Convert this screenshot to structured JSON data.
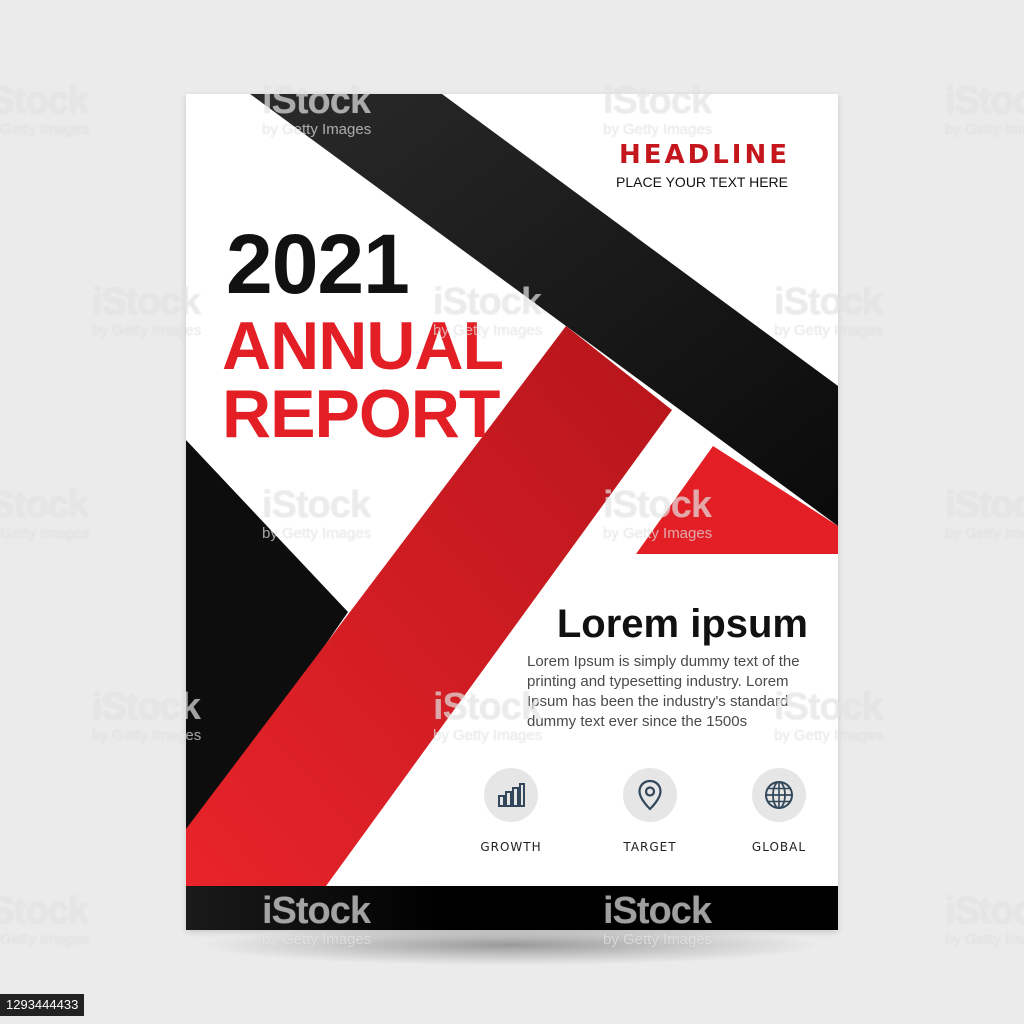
{
  "cover": {
    "year": "2021",
    "title_line1": "ANNUAL",
    "title_line2": "REPORT",
    "headline": "HEADLINE",
    "headline_sub": "PLACE YOUR TEXT HERE",
    "lorem_title": "Lorem ipsum",
    "lorem_body": "Lorem Ipsum is simply dummy text of the printing and typesetting industry. Lorem Ipsum has been the industry's standard dummy text ever since the 1500s",
    "features": [
      {
        "label": "GROWTH",
        "icon": "bar-chart-icon"
      },
      {
        "label": "TARGET",
        "icon": "location-pin-icon"
      },
      {
        "label": "GLOBAL",
        "icon": "globe-icon"
      }
    ]
  },
  "watermark": {
    "brand": "iStock",
    "byline": "by Getty Images"
  },
  "image_id": "1293444433",
  "colors": {
    "accent_red": "#e31e24",
    "dark": "#111111",
    "background": "#ebebeb"
  }
}
